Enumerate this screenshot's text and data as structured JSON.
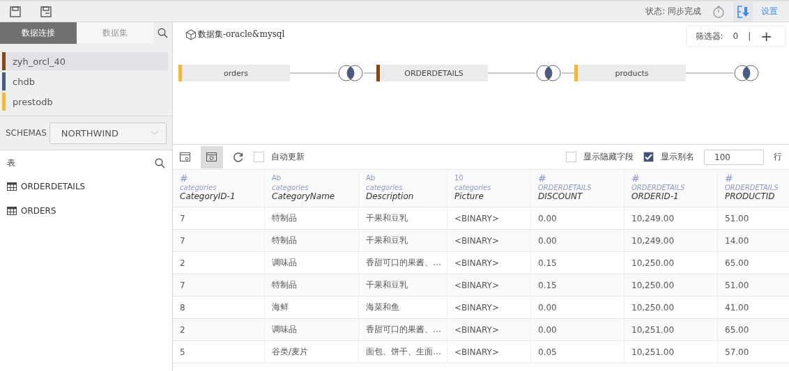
{
  "status": "状态: 同步完成",
  "settings": "设置",
  "left_tabs": [
    {
      "label": "数据连接",
      "selected": true
    },
    {
      "label": "数据集",
      "selected": false
    }
  ],
  "connections": [
    {
      "name": "zyh_orcl_40",
      "color": "#8b4513",
      "selected": true
    },
    {
      "name": "chdb",
      "color": "#4a5a85",
      "selected": false
    },
    {
      "name": "prestodb",
      "color": "#f5b82e",
      "selected": false
    }
  ],
  "schemas": {
    "label": "SCHEMAS",
    "value": "NORTHWIND"
  },
  "tables": {
    "title": "表",
    "items": [
      "ORDERDETAILS",
      "ORDERS"
    ]
  },
  "dataset_title": "数据集-oracle&mysql",
  "filter": {
    "label": "筛选器:",
    "count": "0",
    "separator": "|",
    "add": "+"
  },
  "join_nodes": [
    {
      "name": "orders",
      "color": "#f5b82e"
    },
    {
      "name": "ORDERDETAILS",
      "color": "#8b4513"
    },
    {
      "name": "products",
      "color": "#f5b82e"
    }
  ],
  "options": {
    "auto_update": {
      "label": "自动更新",
      "checked": false
    },
    "show_hidden": {
      "label": "显示隐藏字段",
      "checked": false
    },
    "show_alias": {
      "label": "显示别名",
      "checked": true
    },
    "rows": "100",
    "rows_unit": "行"
  },
  "columns": [
    {
      "glyph": "#",
      "source": "categories",
      "name": "CategoryID-1"
    },
    {
      "glyph": "Ab",
      "source": "categories",
      "name": "CategoryName"
    },
    {
      "glyph": "Ab",
      "source": "categories",
      "name": "Description"
    },
    {
      "glyph": "10",
      "source": "categories",
      "name": "Picture"
    },
    {
      "glyph": "#",
      "source": "ORDERDETAILS",
      "name": "DISCOUNT"
    },
    {
      "glyph": "#",
      "source": "ORDERDETAILS",
      "name": "ORDERID-1"
    },
    {
      "glyph": "#",
      "source": "ORDERDETAILS",
      "name": "PRODUCTID"
    }
  ],
  "rows": [
    [
      "7",
      "特制品",
      "干果和豆乳",
      "<BINARY>",
      "0.00",
      "10,249.00",
      "51.00"
    ],
    [
      "7",
      "特制品",
      "干果和豆乳",
      "<BINARY>",
      "0.00",
      "10,249.00",
      "14.00"
    ],
    [
      "2",
      "调味品",
      "香甜可口的果酱、…",
      "<BINARY>",
      "0.15",
      "10,250.00",
      "65.00"
    ],
    [
      "7",
      "特制品",
      "干果和豆乳",
      "<BINARY>",
      "0.15",
      "10,250.00",
      "51.00"
    ],
    [
      "8",
      "海鲜",
      "海菜和鱼",
      "<BINARY>",
      "0.00",
      "10,250.00",
      "41.00"
    ],
    [
      "2",
      "调味品",
      "香甜可口的果酱、…",
      "<BINARY>",
      "0.00",
      "10,251.00",
      "65.00"
    ],
    [
      "5",
      "谷类/麦片",
      "面包、饼干、生面…",
      "<BINARY>",
      "0.05",
      "10,251.00",
      "57.00"
    ]
  ]
}
